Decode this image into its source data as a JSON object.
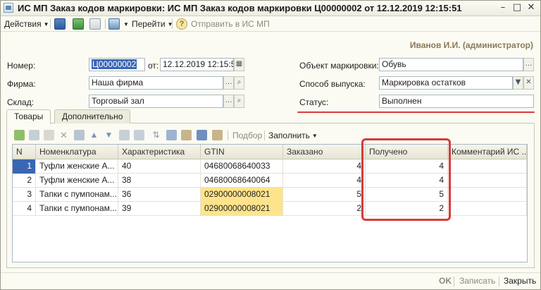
{
  "window": {
    "title": "ИС МП Заказ кодов маркировки: ИС МП Заказ кодов маркировки Ц00000002 от 12.12.2019 12:15:51"
  },
  "toolbar": {
    "actions_label": "Действия",
    "goto_label": "Перейти",
    "send_label": "Отправить в ИС МП"
  },
  "user": "Иванов И.И. (администратор)",
  "form": {
    "number_label": "Номер:",
    "number_value": "Ц00000002",
    "date_label": "от:",
    "date_value": "12.12.2019 12:15:51",
    "firm_label": "Фирма:",
    "firm_value": "Наша фирма",
    "warehouse_label": "Склад:",
    "warehouse_value": "Торговый зал",
    "object_label": "Объект маркировки:",
    "object_value": "Обувь",
    "method_label": "Способ выпуска:",
    "method_value": "Маркировка остатков",
    "status_label": "Статус:",
    "status_value": "Выполнен"
  },
  "tabs": [
    "Товары",
    "Дополнительно"
  ],
  "table_toolbar": {
    "selection_label": "Подбор",
    "fill_label": "Заполнить"
  },
  "table": {
    "columns": [
      "N",
      "Номенклатура",
      "Характеристика",
      "GTIN",
      "Заказано",
      "Получено",
      "Комментарий ИС ..."
    ],
    "rows": [
      {
        "n": "1",
        "name": "Туфли  женские А...",
        "char": "40",
        "gtin": "04680068640033",
        "ordered": "4",
        "received": "4"
      },
      {
        "n": "2",
        "name": "Туфли  женские А...",
        "char": "38",
        "gtin": "04680068640064",
        "ordered": "4",
        "received": "4"
      },
      {
        "n": "3",
        "name": "Тапки с пумпонам...",
        "char": "36",
        "gtin": "02900000008021",
        "ordered": "5",
        "received": "5"
      },
      {
        "n": "4",
        "name": "Тапки с пумпонам...",
        "char": "39",
        "gtin": "02900000008021",
        "ordered": "2",
        "received": "2"
      }
    ]
  },
  "bottom": {
    "ok_label": "OK",
    "save_label": "Записать",
    "close_label": "Закрыть"
  },
  "colors": {
    "highlight": "#fde48c",
    "annotation_red": "#d83b3b",
    "selection": "#3a66b4"
  }
}
